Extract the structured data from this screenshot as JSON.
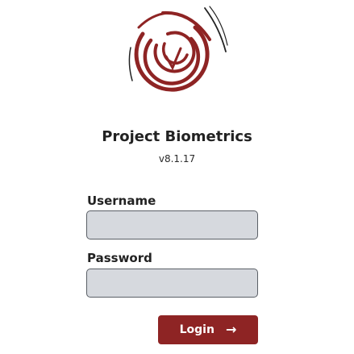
{
  "app": {
    "logo_icon": "fingerprint-logo-icon",
    "title": "Project Biometrics",
    "version": "v8.1.17"
  },
  "form": {
    "username_label": "Username",
    "username_value": "",
    "password_label": "Password",
    "password_value": "",
    "login_label": "Login",
    "login_icon": "arrow-right-icon"
  },
  "colors": {
    "accent": "#8e2424",
    "logo": "#8e2424",
    "field_background": "#d6d9de",
    "field_border": "#5a5f66"
  }
}
